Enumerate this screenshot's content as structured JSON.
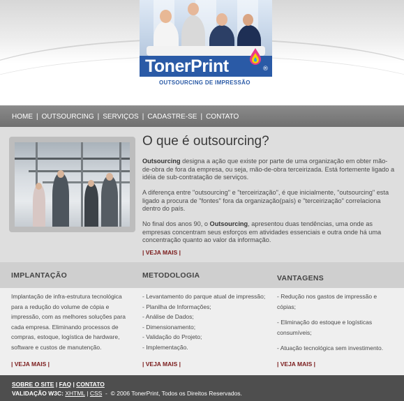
{
  "brand": {
    "logo_text": "TonerPrint",
    "registered": "®",
    "tagline": "OUTSOURCING DE IMPRESSÃO",
    "logo_color": "#2a5aa6"
  },
  "nav": {
    "items": [
      "HOME",
      "OUTSOURCING",
      "SERVIÇOS",
      "CADASTRE-SE",
      "CONTATO"
    ],
    "separator": "|"
  },
  "main": {
    "title": "O que é outsourcing?",
    "p1_strong": "Outsourcing",
    "p1_rest": " designa a ação que existe por parte de uma organização em obter mão-de-obra de fora da empresa, ou seja, mão-de-obra terceirizada. Está fortemente ligado a idéia de sub-contratação de serviços.",
    "p2": "A diferença entre \"outsourcing\" e \"terceirização\", é que inicialmente, \"outsourcing\" esta ligado a procura de \"fontes\" fora da organização(país) e \"terceirização\" correlaciona dentro do país.",
    "p3_a": "No final dos anos 90, o ",
    "p3_strong": "Outsourcing",
    "p3_b": ", apresentou duas tendências, uma onde as empresas concentram seus esforços em atividades essenciais e outra onde há uma concentração quanto ao valor da informação.",
    "more": "| VEJA MAIS |"
  },
  "columns": [
    {
      "title": "IMPLANTAÇÃO",
      "text": "Implantação de infra-estrutura tecnológica para a redução do volume de cópia e impressão, com as melhores soluções para cada empresa. Eliminando processos de compras, estoque, logística de hardware, software e custos de manutenção.",
      "more": "| VEJA MAIS |"
    },
    {
      "title": "METODOLOGIA",
      "items": [
        "- Levantamento do parque atual de impressão;",
        "- Planilha de Informações;",
        "- Análise de Dados;",
        "- Dimensionamento;",
        "- Validação do Projeto;",
        "- Implementação."
      ],
      "more": "| VEJA MAIS |"
    },
    {
      "title": "VANTAGENS",
      "items": [
        "- Redução nos gastos de impressão e cópias;",
        "- Eliminação do estoque e logísticas consumíveis;",
        "- Atuação tecnológica sem investimento."
      ],
      "more": "| VEJA MAIS |"
    }
  ],
  "footer": {
    "links": [
      "SOBRE O SITE",
      "FAQ",
      "CONTATO"
    ],
    "sep": "|",
    "validation_label": "VALIDAÇÃO W3C:",
    "xhtml": "XHTML",
    "css": "CSS",
    "copyright": "© 2006 TonerPrint, Todos os Direitos Reservados."
  }
}
